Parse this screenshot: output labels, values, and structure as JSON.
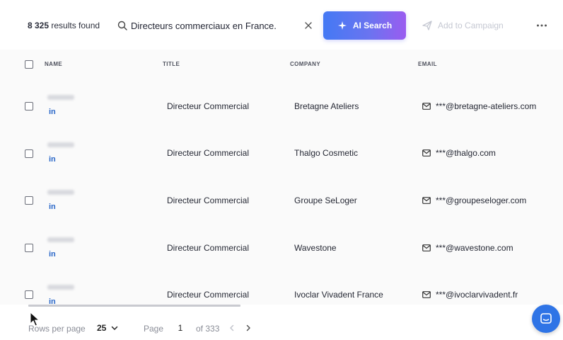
{
  "header": {
    "results_count": "8 325",
    "results_suffix": "results found",
    "search_value": "Directeurs commerciaux en France.",
    "ai_search_label": "AI Search",
    "campaign_label": "Add to Campaign"
  },
  "table": {
    "columns": [
      "NAME",
      "TITLE",
      "COMPANY",
      "EMAIL"
    ],
    "rows": [
      {
        "linkedin": "in",
        "title": "Directeur Commercial",
        "company": "Bretagne Ateliers",
        "email": "***@bretagne-ateliers.com"
      },
      {
        "linkedin": "in",
        "title": "Directeur Commercial",
        "company": "Thalgo Cosmetic",
        "email": "***@thalgo.com"
      },
      {
        "linkedin": "in",
        "title": "Directeur Commercial",
        "company": "Groupe SeLoger",
        "email": "***@groupeseloger.com"
      },
      {
        "linkedin": "in",
        "title": "Directeur Commercial",
        "company": "Wavestone",
        "email": "***@wavestone.com"
      },
      {
        "linkedin": "in",
        "title": "Directeur Commercial",
        "company": "Ivoclar Vivadent France",
        "email": "***@ivoclarvivadent.fr"
      }
    ]
  },
  "footer": {
    "rows_per_page_label": "Rows per page",
    "rows_per_page_value": "25",
    "page_label": "Page",
    "page_value": "1",
    "page_total": "of 333"
  },
  "colors": {
    "accent": "#3c6df0",
    "ai_gradient_start": "#4479f4",
    "ai_gradient_end": "#9a5cf0",
    "linkedin": "#2a67c8",
    "chat": "#2f74e6"
  },
  "icons": [
    "search-icon",
    "close-icon",
    "sparkle-icon",
    "send-icon",
    "more-icon",
    "mail-icon",
    "chevron-down-icon",
    "chevron-left-icon",
    "chevron-right-icon",
    "chat-icon",
    "cursor-icon"
  ]
}
